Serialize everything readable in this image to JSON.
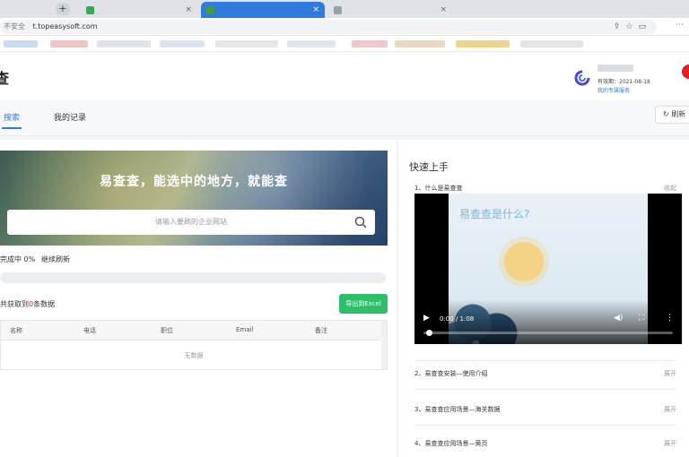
{
  "browser": {
    "tabs": [
      {
        "label": "",
        "fav_color": "#3aa757",
        "state": "normal"
      },
      {
        "label": "",
        "fav_color": "#4a9a3a",
        "state": "highlight"
      },
      {
        "label": "",
        "fav_color": "#9aa0a6",
        "state": "normal"
      }
    ],
    "new_tab_label": "+",
    "url_security": "不安全",
    "url": "t.topeasysoft.com"
  },
  "header": {
    "logo_char": "查",
    "account_expiry": "有效期：2021-08-18",
    "account_link": "我的专属服务",
    "colors": {
      "accent": "#2f7be0",
      "badge": "#e02020"
    }
  },
  "subnav": {
    "tabs": [
      {
        "label": "搜索",
        "active": true
      },
      {
        "label": "我的记录",
        "active": false
      }
    ],
    "refresh_label": "刷新"
  },
  "left": {
    "hero_title": "易查查，能选中的地方，就能查",
    "search_placeholder": "请输入要刷的企业网站",
    "progress_label": "完成中 0%",
    "progress_link": "继续刷新",
    "progress_value": 0,
    "count_prefix": "共获取到",
    "count_value": "0",
    "count_suffix": "条数据",
    "export_label": "导出到Excel",
    "table_headers": [
      "名称",
      "电话",
      "职位",
      "Email",
      "备注"
    ],
    "empty_text": "无数据"
  },
  "right": {
    "title": "快速上手",
    "items": [
      {
        "label": "1、什么是易查查",
        "action": "收起"
      },
      {
        "label": "2、易查查安装—使用介绍",
        "action": "展开"
      },
      {
        "label": "3、易查查应用场景—海关数据",
        "action": "展开"
      },
      {
        "label": "4、易查查应用场景—黄页",
        "action": "展开"
      }
    ],
    "video": {
      "frame_title": "易查查是什么?",
      "time": "0:00 / 1:08",
      "progress": 0.02
    }
  }
}
